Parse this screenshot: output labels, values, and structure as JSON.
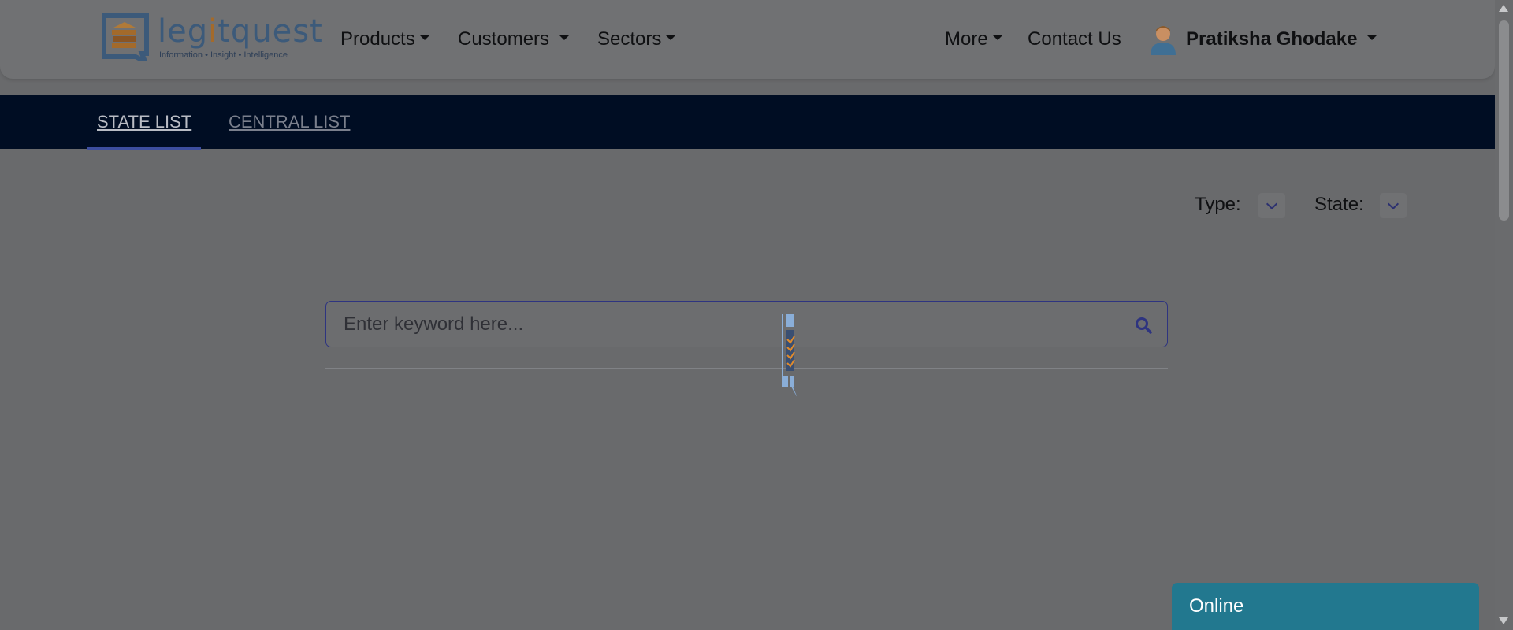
{
  "header": {
    "logo": {
      "text_prefix": "leg",
      "text_accent": "i",
      "text_suffix": "tquest",
      "tagline": "Information • Insight • Intelligence"
    },
    "nav": {
      "products": "Products",
      "customers": "Customers",
      "sectors": "Sectors",
      "more": "More",
      "contact": "Contact Us",
      "user_name": "Pratiksha Ghodake"
    }
  },
  "tabs": {
    "state": "STATE LIST",
    "central": "CENTRAL LIST"
  },
  "filters": {
    "type_label": "Type:",
    "state_label": "State:"
  },
  "search": {
    "placeholder": "Enter keyword here..."
  },
  "chat": {
    "status": "Online"
  },
  "colors": {
    "header_bg": "#707173",
    "tabbar_bg": "#000d23",
    "chat_bg": "#22788f",
    "accent": "#2e3480"
  }
}
